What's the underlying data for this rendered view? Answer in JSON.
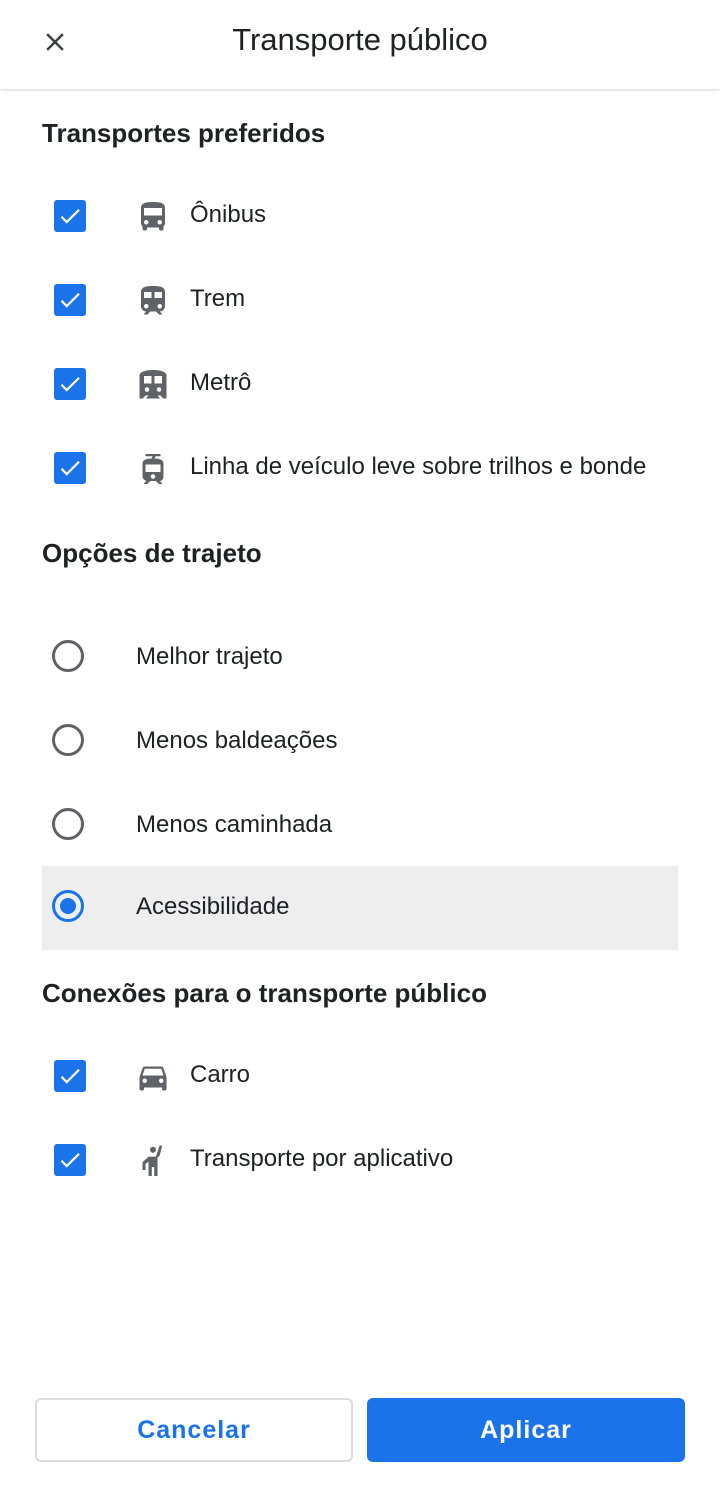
{
  "header": {
    "title": "Transporte público",
    "close_icon": "close-icon"
  },
  "preferred": {
    "title": "Transportes preferidos",
    "items": [
      {
        "label": "Ônibus",
        "checked": true,
        "icon": "bus-icon"
      },
      {
        "label": "Trem",
        "checked": true,
        "icon": "train-icon"
      },
      {
        "label": "Metrô",
        "checked": true,
        "icon": "subway-icon"
      },
      {
        "label": "Linha de veículo leve sobre trilhos e bonde",
        "checked": true,
        "icon": "tram-icon"
      }
    ]
  },
  "route_options": {
    "title": "Opções de trajeto",
    "items": [
      {
        "label": "Melhor trajeto",
        "selected": false
      },
      {
        "label": "Menos baldeações",
        "selected": false
      },
      {
        "label": "Menos caminhada",
        "selected": false
      },
      {
        "label": "Acessibilidade",
        "selected": true
      }
    ]
  },
  "connections": {
    "title": "Conexões para o transporte público",
    "items": [
      {
        "label": "Carro",
        "checked": true,
        "icon": "car-icon"
      },
      {
        "label": "Transporte por aplicativo",
        "checked": true,
        "icon": "ride-hail-icon"
      }
    ]
  },
  "actions": {
    "cancel_label": "Cancelar",
    "apply_label": "Aplicar"
  },
  "colors": {
    "accent": "#1a73e8",
    "icon_gray": "#5f6368",
    "selected_bg": "#eeeeee"
  }
}
